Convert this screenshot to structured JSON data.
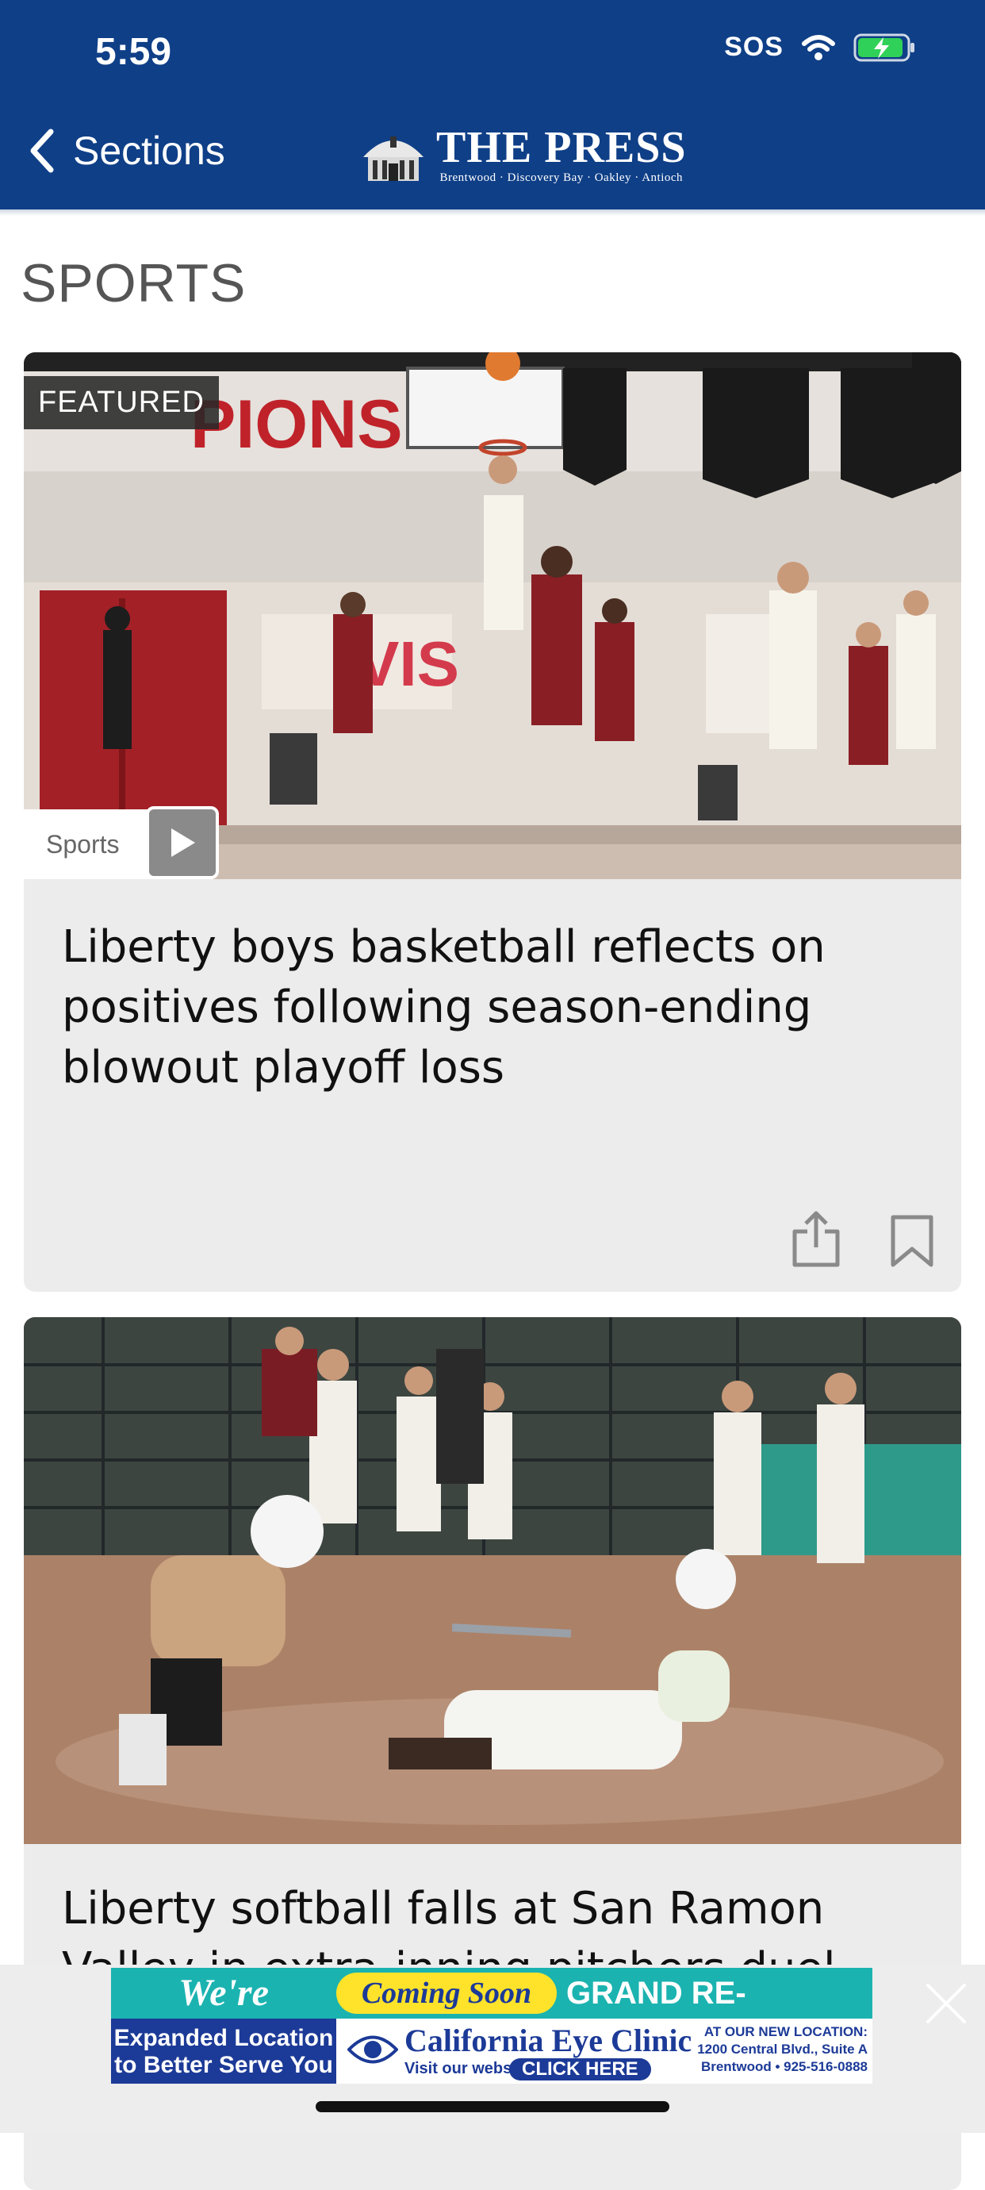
{
  "status_bar": {
    "time": "5:59",
    "carrier": "SOS"
  },
  "header": {
    "back_label": "Sections",
    "logo_name": "THE PRESS",
    "logo_tagline": "Brentwood · Discovery Bay · Oakley · Antioch",
    "background_color": "#0f3f87"
  },
  "section": {
    "title": "SPORTS"
  },
  "articles": [
    {
      "badge": "FEATURED",
      "category": "Sports",
      "headline": "Liberty boys basketball reflects on positives following season-ending blowout playoff loss",
      "has_video": true,
      "actions": [
        "share-icon",
        "bookmark-icon"
      ]
    },
    {
      "headline": "Liberty softball falls at San Ramon Valley in extra-inning pitchers duel"
    }
  ],
  "ad": {
    "moving": "We're moving!",
    "expanded": "Expanded Location to Better Serve You",
    "coming_soon": "Coming Soon",
    "grand": "GRAND RE-OPENING",
    "clinic": "California Eye Clinic",
    "visit": "Visit our website",
    "click": "CLICK HERE",
    "address_1": "AT OUR NEW LOCATION:",
    "address_2": "1200 Central Blvd., Suite A",
    "address_3": "Brentwood • 925-516-0888"
  },
  "colors": {
    "accent": "#0f3f87",
    "card_bg": "#ececec",
    "ad_teal": "#1bb3b0",
    "ad_blue": "#1c3a97",
    "ad_yellow": "#ffe32a"
  }
}
